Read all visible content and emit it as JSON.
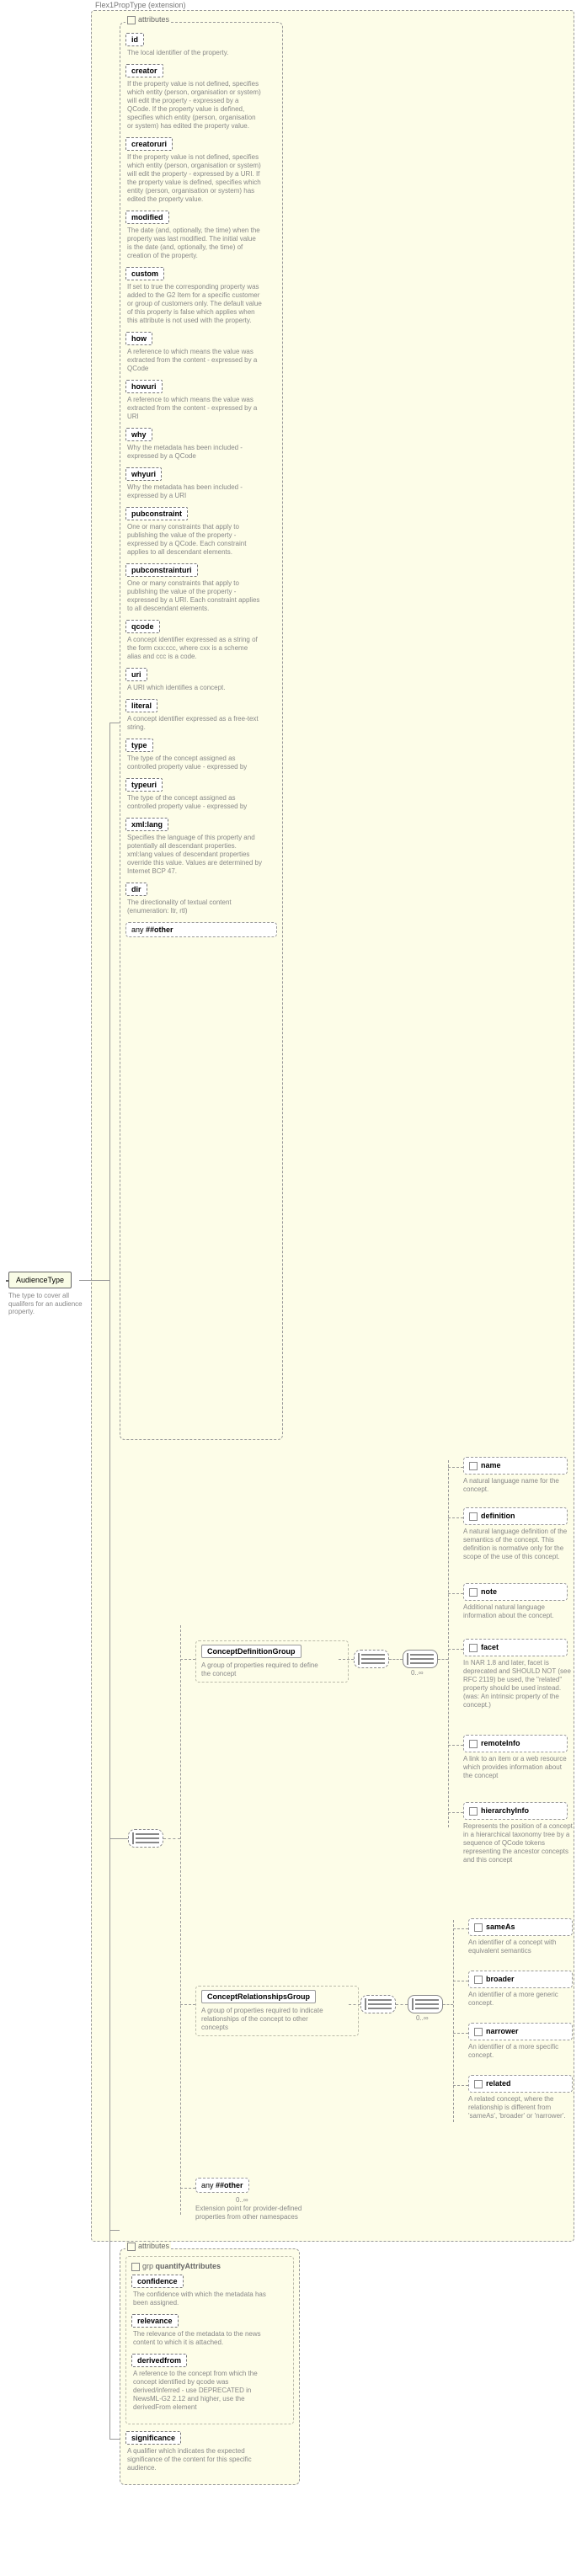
{
  "root": {
    "name": "AudienceType",
    "desc": "The type to cover all qualifers for an audience property."
  },
  "extension": {
    "title": "Flex1PropType (extension)"
  },
  "attributes_header": "attributes",
  "attrs": {
    "id": {
      "name": "id",
      "desc": "The local identifier of the property."
    },
    "creator": {
      "name": "creator",
      "desc": "If the property value is not defined, specifies which entity (person, organisation or system) will edit the property - expressed by a QCode. If the property value is defined, specifies which entity (person, organisation or system) has edited the property value."
    },
    "creatoruri": {
      "name": "creatoruri",
      "desc": "If the property value is not defined, specifies which entity (person, organisation or system) will edit the property - expressed by a URI. If the property value is defined, specifies which entity (person, organisation or system) has edited the property value."
    },
    "modified": {
      "name": "modified",
      "desc": "The date (and, optionally, the time) when the property was last modified. The initial value is the date (and, optionally, the time) of creation of the property."
    },
    "custom": {
      "name": "custom",
      "desc": "If set to true the corresponding property was added to the G2 Item for a specific customer or group of customers only. The default value of this property is false which applies when this attribute is not used with the property."
    },
    "how": {
      "name": "how",
      "desc": "A reference to which means the value was extracted from the content - expressed by a QCode"
    },
    "howuri": {
      "name": "howuri",
      "desc": "A reference to which means the value was extracted from the content - expressed by a URI"
    },
    "why": {
      "name": "why",
      "desc": "Why the metadata has been included - expressed by a QCode"
    },
    "whyuri": {
      "name": "whyuri",
      "desc": "Why the metadata has been included - expressed by a URI"
    },
    "pubconstraint": {
      "name": "pubconstraint",
      "desc": "One or many constraints that apply to publishing the value of the property - expressed by a QCode. Each constraint applies to all descendant elements."
    },
    "pubconstrainturi": {
      "name": "pubconstrainturi",
      "desc": "One or many constraints that apply to publishing the value of the property - expressed by a URI. Each constraint applies to all descendant elements."
    },
    "qcode": {
      "name": "qcode",
      "desc": "A concept identifier expressed as a string of the form cxx:ccc, where cxx is a scheme alias and ccc is a code."
    },
    "uri": {
      "name": "uri",
      "desc": "A URI which identifies a concept."
    },
    "literal": {
      "name": "literal",
      "desc": "A concept identifier expressed as a free-text string."
    },
    "type": {
      "name": "type",
      "desc": "The type of the concept assigned as controlled property value - expressed by"
    },
    "typeuri": {
      "name": "typeuri",
      "desc": "The type of the concept assigned as controlled property value - expressed by"
    },
    "xmllang": {
      "name": "xml:lang",
      "desc": "Specifies the language of this property and potentially all descendant properties. xml:lang values of descendant properties override this value. Values are determined by Internet BCP 47."
    },
    "dir": {
      "name": "dir",
      "desc": "The directionality of textual content (enumeration: ltr, rtl)"
    }
  },
  "any_other": "##other",
  "any_label": "any",
  "cdg": {
    "title": "ConceptDefinitionGroup",
    "desc": "A group of properties required to define the concept"
  },
  "crg": {
    "title": "ConceptRelationshipsGroup",
    "desc": "A group of properties required to indicate relationships of the concept to other concepts"
  },
  "cards": {
    "zero_inf": "0..∞"
  },
  "cdg_children": {
    "name": {
      "title": "name",
      "desc": "A natural language name for the concept."
    },
    "definition": {
      "title": "definition",
      "desc": "A natural language definition of the semantics of the concept. This definition is normative only for the scope of the use of this concept."
    },
    "note": {
      "title": "note",
      "desc": "Additional natural language information about the concept."
    },
    "facet": {
      "title": "facet",
      "desc": "In NAR 1.8 and later, facet is deprecated and SHOULD NOT (see RFC 2119) be used, the \"related\" property should be used instead. (was: An intrinsic property of the concept.)"
    },
    "remoteInfo": {
      "title": "remoteInfo",
      "desc": "A link to an item or a web resource which provides information about the concept"
    },
    "hierarchyInfo": {
      "title": "hierarchyInfo",
      "desc": "Represents the position of a concept in a hierarchical taxonomy tree by a sequence of QCode tokens representing the ancestor concepts and this concept"
    }
  },
  "crg_children": {
    "sameAs": {
      "title": "sameAs",
      "desc": "An identifier of a concept with equivalent semantics"
    },
    "broader": {
      "title": "broader",
      "desc": "An identifier of a more generic concept."
    },
    "narrower": {
      "title": "narrower",
      "desc": "An identifier of a more specific concept."
    },
    "related": {
      "title": "related",
      "desc": "A related concept, where the relationship is different from 'sameAs', 'broader' or 'narrower'."
    }
  },
  "ext_point_desc": "Extension point for provider-defined properties from other namespaces",
  "quantify": {
    "header": "attributes",
    "grp_label": "grp",
    "grp_name": "quantifyAttributes",
    "items": {
      "confidence": {
        "name": "confidence",
        "desc": "The confidence with which the metadata has been assigned."
      },
      "relevance": {
        "name": "relevance",
        "desc": "The relevance of the metadata to the news content to which it is attached."
      },
      "derivedfrom": {
        "name": "derivedfrom",
        "desc": "A reference to the concept from which the concept identified by qcode was derived/inferred - use DEPRECATED in NewsML-G2 2.12 and higher, use the derivedFrom element"
      },
      "significance": {
        "name": "significance",
        "desc": "A qualifier which indicates the expected significance of the content for this specific audience."
      }
    }
  }
}
